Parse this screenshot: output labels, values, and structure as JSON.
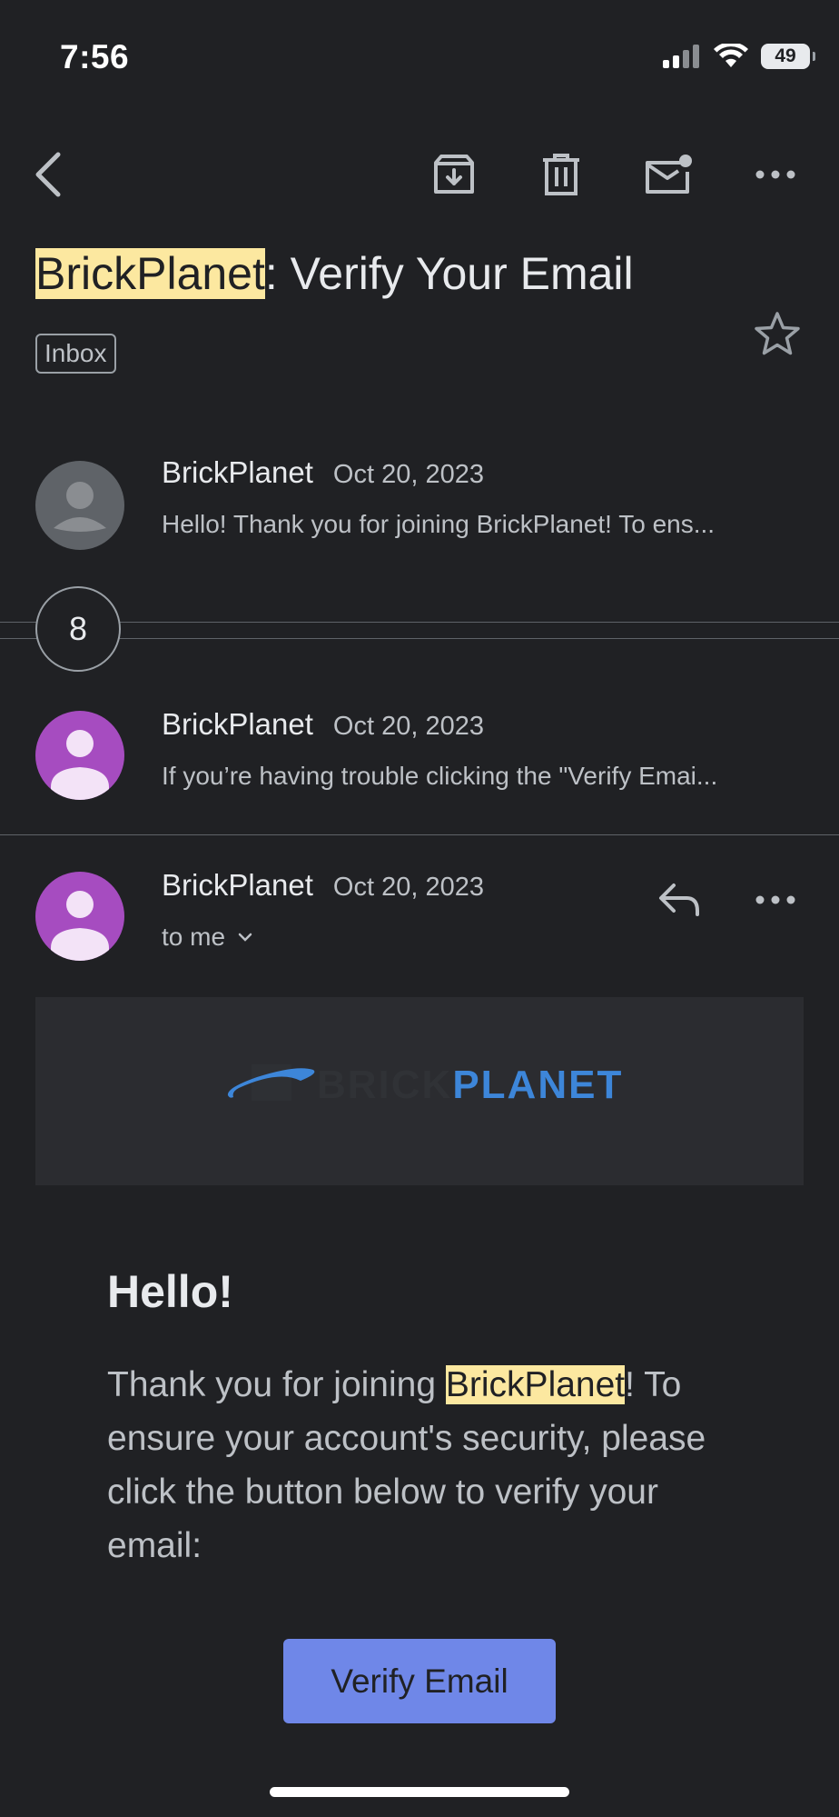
{
  "status_bar": {
    "time": "7:56",
    "battery": "49"
  },
  "subject": {
    "highlight": "BrickPlanet",
    "rest": ": Verify Your Email"
  },
  "label": "Inbox",
  "collapsed_count": "8",
  "messages": [
    {
      "sender": "BrickPlanet",
      "date": "Oct 20, 2023",
      "snippet": "Hello! Thank you for joining BrickPlanet! To ens..."
    },
    {
      "sender": "BrickPlanet",
      "date": "Oct 20, 2023",
      "snippet": "If you’re having trouble clicking the \"Verify Emai..."
    },
    {
      "sender": "BrickPlanet",
      "date": "Oct 20, 2023",
      "recipient": "to me"
    }
  ],
  "email_body": {
    "logo_dim": "BRICK",
    "logo_bright": "PLANET",
    "greeting": "Hello!",
    "para_before": "Thank you for joining ",
    "para_highlight": "BrickPlanet",
    "para_after": "! To ensure your account's security, please click the button below to verify your email:",
    "button_label": "Verify Email"
  },
  "colors": {
    "background": "#202124",
    "highlight": "#fce8a0",
    "button": "#6f87e8",
    "avatar_purple": "#a64cc0",
    "logo_blue": "#3d86d9"
  }
}
